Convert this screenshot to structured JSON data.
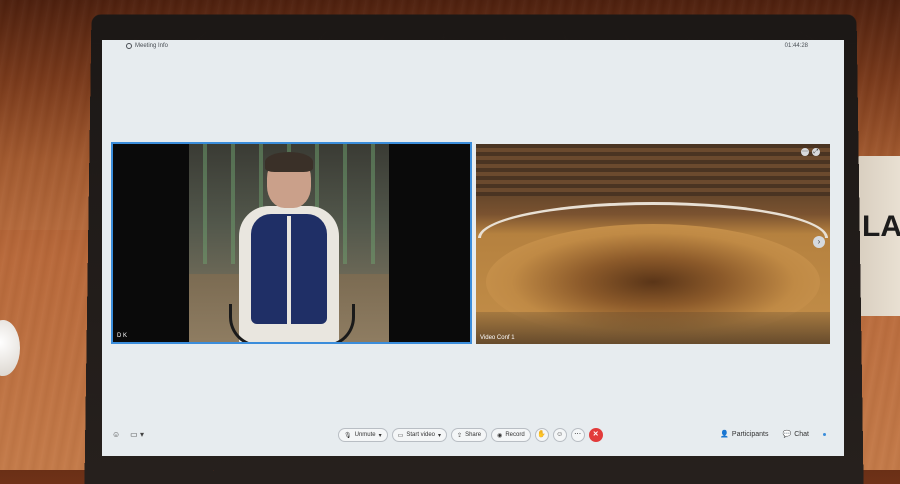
{
  "window": {
    "meeting_info_label": "Meeting Info",
    "time": "01:44:28"
  },
  "tiles": {
    "left": {
      "name": "D K"
    },
    "right": {
      "name": "Video Conf 1"
    }
  },
  "toolbar": {
    "unmute": "Unmute",
    "start_video": "Start video",
    "share": "Share",
    "record": "Record",
    "participants": "Participants",
    "chat": "Chat"
  },
  "room": {
    "nameplate_text": "LA"
  }
}
